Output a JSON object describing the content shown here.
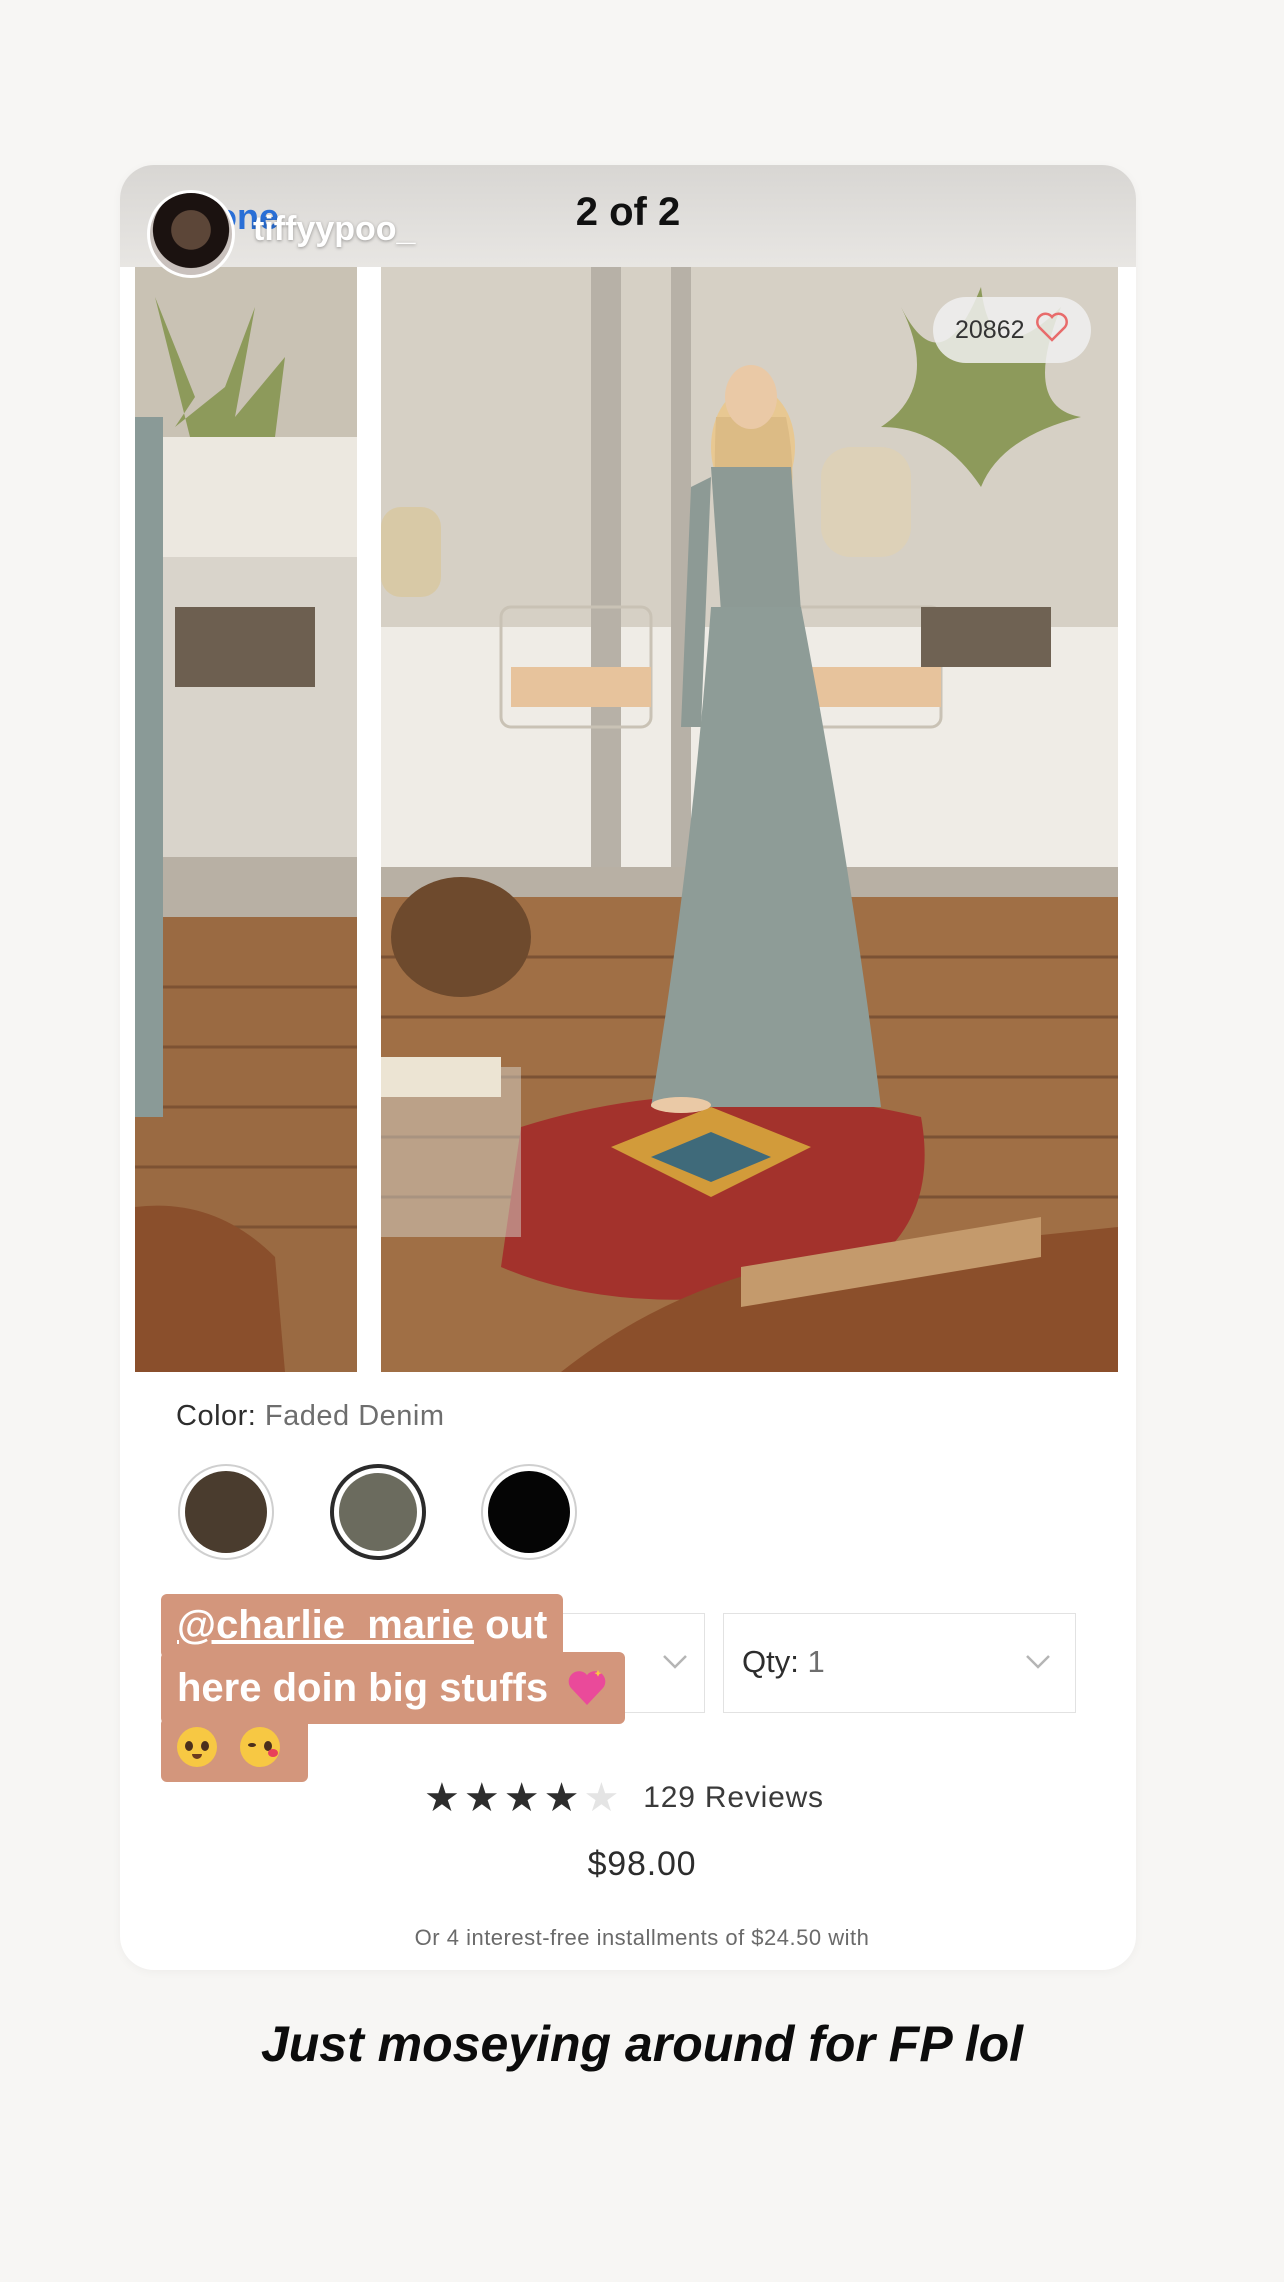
{
  "story": {
    "counter": "2 of 2",
    "ghost_text": "one",
    "username": "tiffyypoo_",
    "caption": "Just moseying around for FP lol"
  },
  "product": {
    "likes": "20862",
    "color_label": "Color:",
    "color_value": "Faded Denim",
    "swatches": [
      {
        "color": "#4a3c2e"
      },
      {
        "color": "#6b6b5e"
      },
      {
        "color": "#050505"
      }
    ],
    "qty_label": "Qty:",
    "qty_value": "1",
    "rating": 4,
    "reviews": "129 Reviews",
    "price": "$98.00",
    "installments": "Or 4 interest-free installments of $24.50 with"
  },
  "sticker": {
    "mention": "@charlie_marie",
    "line1_rest": "out",
    "line2": "here doin big stuffs"
  },
  "colors": {
    "sticker_bg": "#d3967c",
    "like_heart": "#e86b6b",
    "background": "#f7f6f4"
  },
  "icons": [
    "heart-icon",
    "chevron-down-icon",
    "star-icon",
    "sparkling-heart-emoji",
    "pleading-face-emoji",
    "kissing-face-emoji"
  ]
}
